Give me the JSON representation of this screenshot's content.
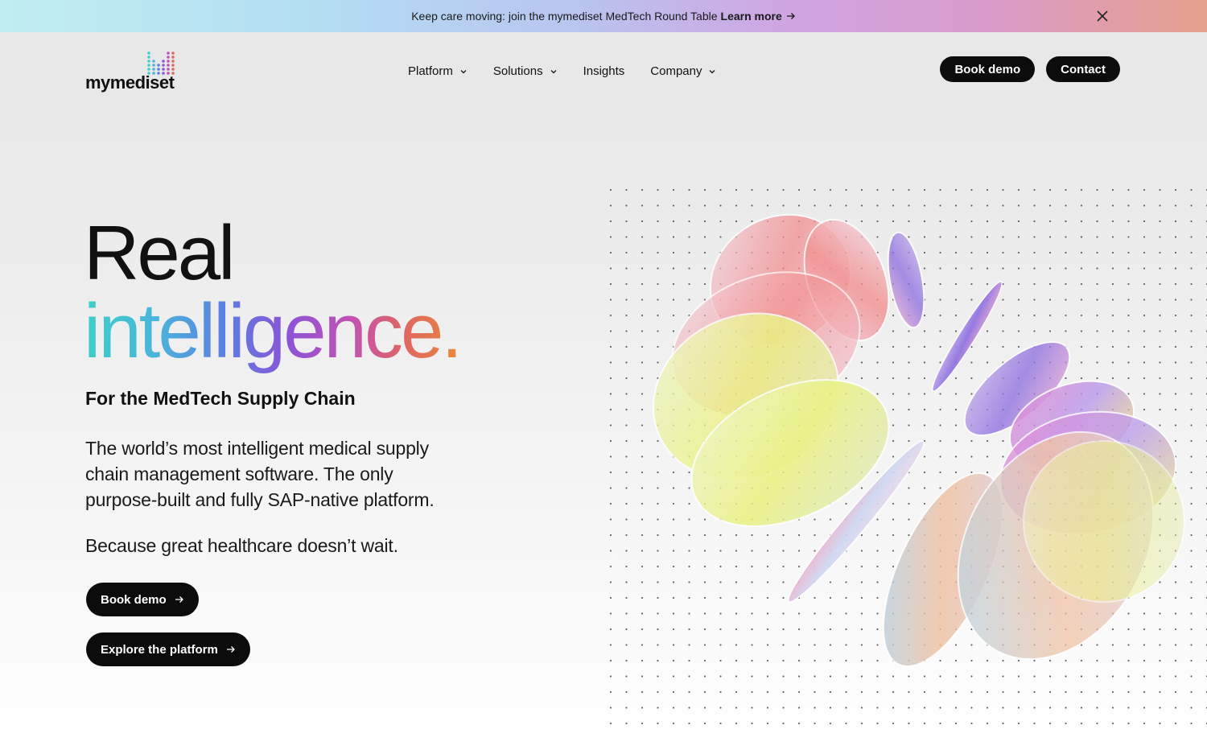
{
  "announcement": {
    "message": "Keep care moving: join the mymediset MedTech Round Table",
    "link_label": "Learn more"
  },
  "brand": {
    "name": "mymediset"
  },
  "nav": {
    "items": [
      {
        "label": "Platform",
        "dropdown": true
      },
      {
        "label": "Solutions",
        "dropdown": true
      },
      {
        "label": "Insights",
        "dropdown": false
      },
      {
        "label": "Company",
        "dropdown": true
      }
    ]
  },
  "header_actions": {
    "book_demo": "Book demo",
    "contact": "Contact"
  },
  "hero": {
    "title_line1": "Real",
    "title_line2": "intelligence.",
    "subtitle": "For the MedTech Supply Chain",
    "description": "The world’s most intelligent medical supply chain management software. The only purpose-built and fully SAP-native platform.",
    "tagline": "Because great healthcare doesn’t wait.",
    "cta_primary": "Book demo",
    "cta_secondary": "Explore the platform"
  },
  "colors": {
    "button_bg": "#0c0c0c",
    "gradient": [
      "#3dd0c8",
      "#5c7ee0",
      "#8a55d6",
      "#c050b8",
      "#e88a3c"
    ]
  },
  "icons": [
    "close-icon",
    "chevron-down-icon",
    "arrow-right-icon",
    "logo-mark-icon"
  ]
}
